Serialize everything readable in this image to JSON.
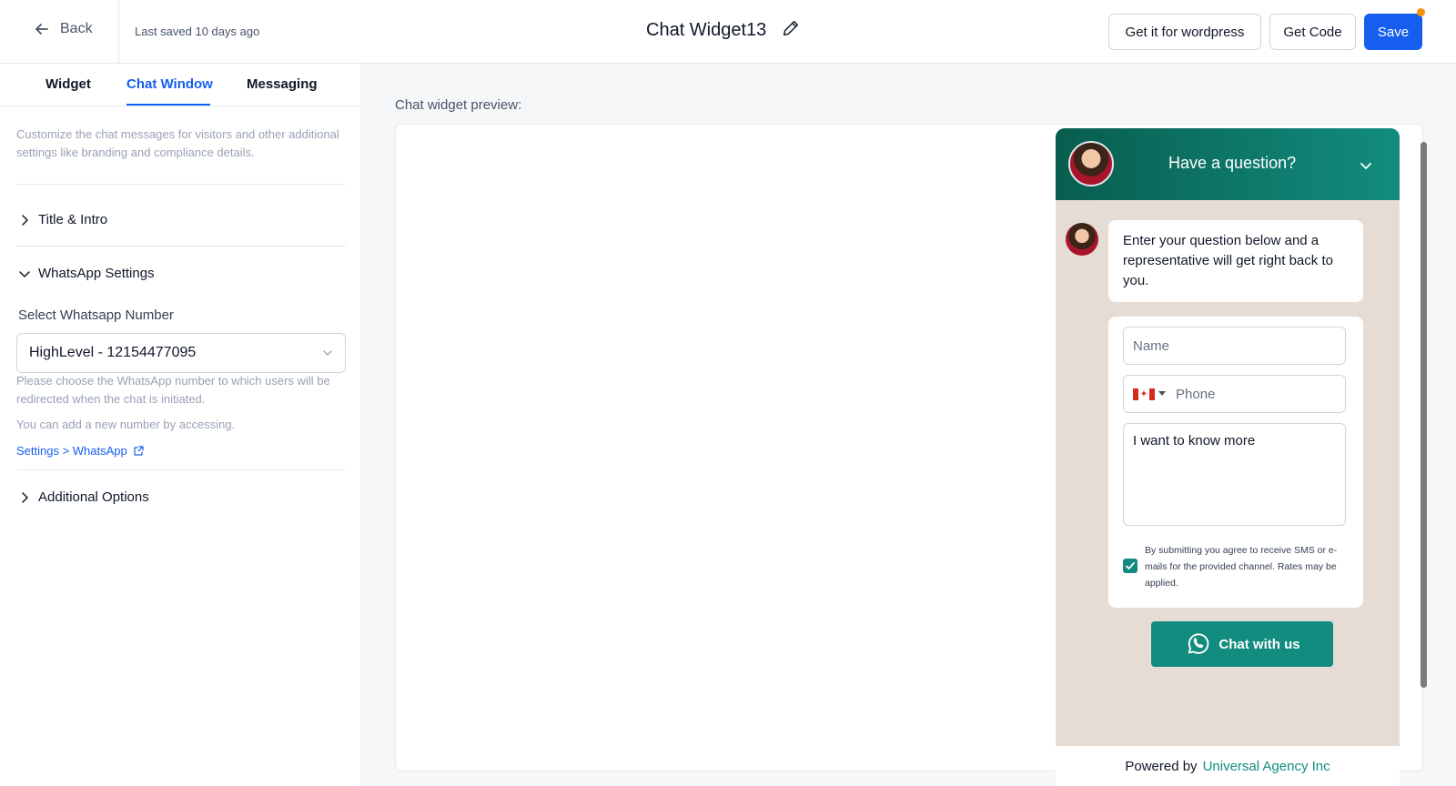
{
  "header": {
    "back_label": "Back",
    "last_saved": "Last saved 10 days ago",
    "widget_name": "Chat Widget13",
    "wordpress_label": "Get it for wordpress",
    "get_code_label": "Get Code",
    "save_label": "Save"
  },
  "tabs": [
    {
      "label": "Widget",
      "active": false
    },
    {
      "label": "Chat Window",
      "active": true
    },
    {
      "label": "Messaging",
      "active": false
    }
  ],
  "sidebar": {
    "description": "Customize the chat messages for visitors and other additional settings like branding and compliance details.",
    "sections": {
      "title_intro": "Title & Intro",
      "whatsapp_settings": "WhatsApp Settings",
      "additional_options": "Additional Options"
    },
    "whatsapp": {
      "field_label": "Select Whatsapp Number",
      "selected_value": "HighLevel - 12154477095",
      "help_text": "Please choose the WhatsApp number to which users will be redirected when the chat is initiated.",
      "add_number_text": "You can add a new number by accessing.",
      "settings_link": "Settings > WhatsApp"
    }
  },
  "preview": {
    "label": "Chat widget preview:",
    "widget": {
      "heading": "Have a question?",
      "intro_message": "Enter your question below and a representative will get right back to you.",
      "name_placeholder": "Name",
      "phone_placeholder": "Phone",
      "message_value": "I want to know more",
      "consent_text": "By submitting you agree to receive SMS or e-mails for the provided channel. Rates may be applied.",
      "consent_checked": true,
      "cta_label": "Chat with us",
      "powered_by": "Powered by",
      "brand_name": "Universal Agency Inc"
    }
  },
  "colors": {
    "accent": "#155eef",
    "whatsapp_green": "#128c7e",
    "widget_header_dark": "#085e4f",
    "chat_background": "#e5ddd5",
    "notification_dot": "#f79009"
  },
  "icons": {
    "back": "arrow-left-icon",
    "edit": "pencil-icon",
    "collapse": "chevron-right-icon",
    "expand": "chevron-down-icon",
    "external": "external-link-icon",
    "whatsapp": "whatsapp-icon",
    "flag": "canada-flag-icon"
  }
}
